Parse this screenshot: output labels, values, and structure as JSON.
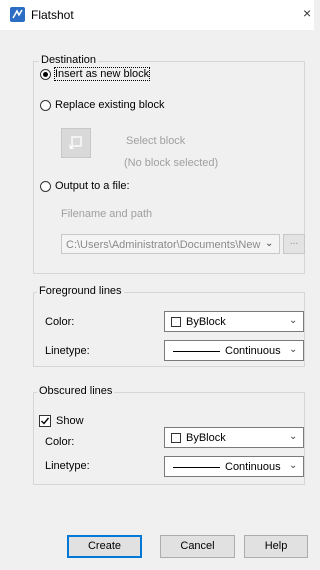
{
  "window": {
    "title": "Flatshot",
    "close_glyph": "×"
  },
  "destination": {
    "legend": "Destination",
    "insert_label": "Insert as new block",
    "replace_label": "Replace existing block",
    "select_block_label": "Select block",
    "no_block_label": "(No block selected)",
    "output_label": "Output to a file:",
    "filename_label": "Filename and path",
    "path_value": "C:\\Users\\Administrator\\Documents\\New",
    "browse_label": "...",
    "selected_option": "insert"
  },
  "foreground": {
    "legend": "Foreground lines",
    "color_label": "Color:",
    "color_value": "ByBlock",
    "linetype_label": "Linetype:",
    "linetype_value": "Continuous"
  },
  "obscured": {
    "legend": "Obscured lines",
    "show_label": "Show",
    "show_checked": true,
    "color_label": "Color:",
    "color_value": "ByBlock",
    "linetype_label": "Linetype:",
    "linetype_value": "Continuous"
  },
  "buttons": {
    "create": "Create",
    "cancel": "Cancel",
    "help": "Help"
  },
  "icons": {
    "app": "flatshot-app-icon",
    "select": "select-block-icon",
    "dropdown": "chevron-down-icon",
    "close": "close-icon"
  },
  "colors": {
    "accent": "#0078d7",
    "app_icon": "#2b6cc4",
    "dialog_bg": "#f0f0f0"
  }
}
